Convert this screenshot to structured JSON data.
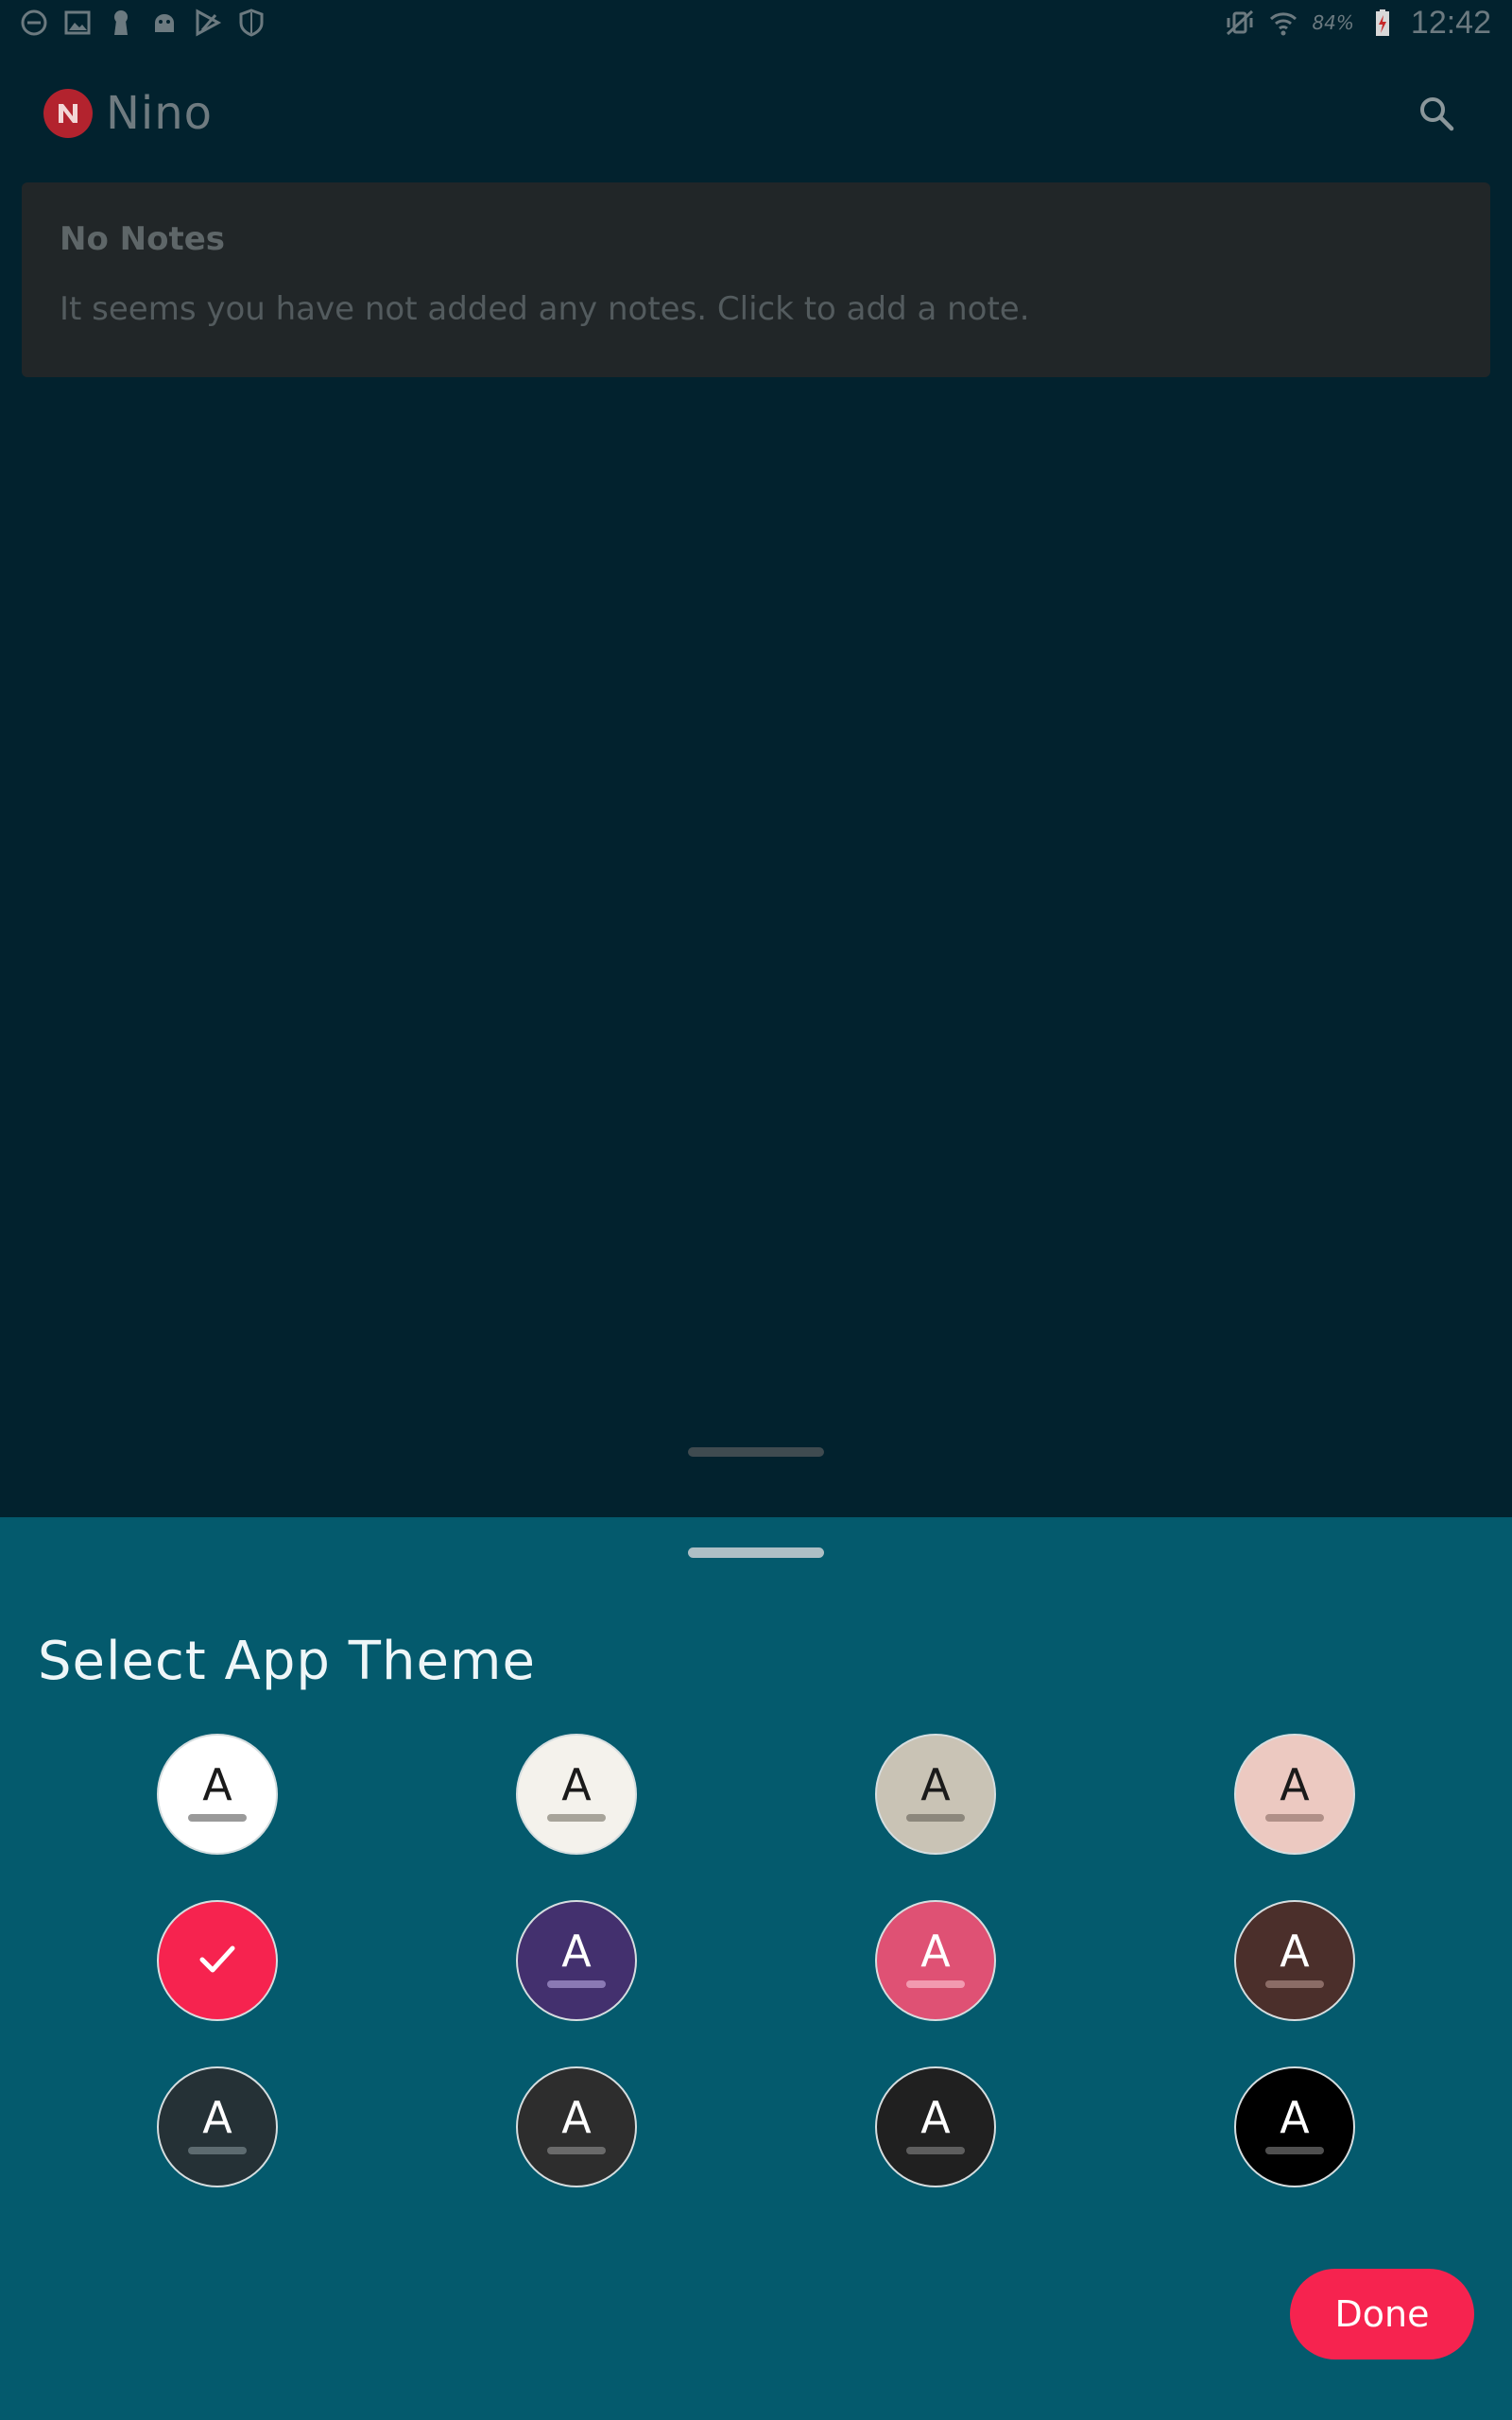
{
  "status_bar": {
    "left_icons": [
      "do-not-disturb-icon",
      "gallery-icon",
      "keyhole-icon",
      "android-icon",
      "play-store-icon",
      "shield-icon"
    ],
    "right_icons": [
      "vibrate-icon",
      "wifi-icon",
      "battery-icon"
    ],
    "battery": "84%",
    "time": "12:42"
  },
  "app_bar": {
    "title": "Nino",
    "logo_letter": "N",
    "logo_color": "#b3232e"
  },
  "notes_empty": {
    "title": "No Notes",
    "message": "It seems you have not added any notes. Click to add a note."
  },
  "theme_sheet": {
    "title": "Select App Theme",
    "selected_index": 4,
    "themes": [
      {
        "letter": "A",
        "bg": "#ffffff",
        "fg": "#1a1a1a",
        "bar": "#9a9a9a"
      },
      {
        "letter": "A",
        "bg": "#f4f2ec",
        "fg": "#1a1a1a",
        "bar": "#a7a49a"
      },
      {
        "letter": "A",
        "bg": "#c9c3b5",
        "fg": "#1a1a1a",
        "bar": "#8c877c"
      },
      {
        "letter": "A",
        "bg": "#ecc9c1",
        "fg": "#1a1a1a",
        "bar": "#b09088"
      },
      {
        "letter": "",
        "bg": "#f6234f",
        "fg": "#ffffff",
        "bar": "",
        "selected": true
      },
      {
        "letter": "A",
        "bg": "#43306e",
        "fg": "#ffffff",
        "bar": "#8a79b4"
      },
      {
        "letter": "A",
        "bg": "#df5174",
        "fg": "#ffffff",
        "bar": "#f29ab0"
      },
      {
        "letter": "A",
        "bg": "#4b2f2b",
        "fg": "#ffffff",
        "bar": "#8b6c66"
      },
      {
        "letter": "A",
        "bg": "#253136",
        "fg": "#ffffff",
        "bar": "#5d6b70"
      },
      {
        "letter": "A",
        "bg": "#2d2d2d",
        "fg": "#ffffff",
        "bar": "#6a6a6a"
      },
      {
        "letter": "A",
        "bg": "#202020",
        "fg": "#ffffff",
        "bar": "#5e5e5e"
      },
      {
        "letter": "A",
        "bg": "#000000",
        "fg": "#ffffff",
        "bar": "#4f4f4f"
      }
    ],
    "done_label": "Done",
    "accent": "#f6234f"
  }
}
